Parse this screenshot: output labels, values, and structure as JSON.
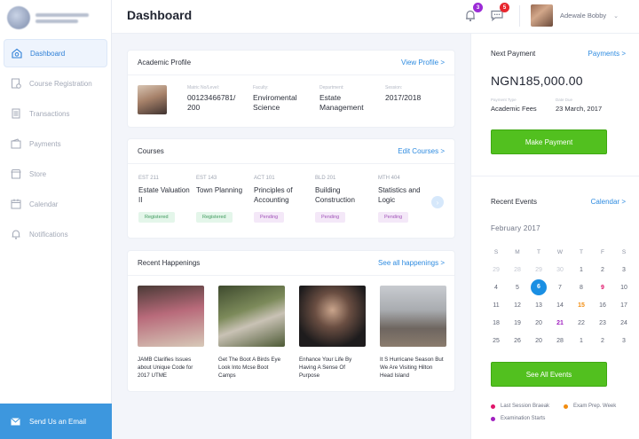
{
  "colors": {
    "accent": "#2e8be0",
    "brand_green": "#52c01f",
    "sidebar_button": "#3d97de",
    "today": "#1a8fe3",
    "event_red": "#e0156a",
    "event_orange": "#f28c0f",
    "event_purple": "#a020c0"
  },
  "sidebar": {
    "items": [
      {
        "label": "Dashboard",
        "icon": "home-icon"
      },
      {
        "label": "Course Registration",
        "icon": "document-icon"
      },
      {
        "label": "Transactions",
        "icon": "list-icon"
      },
      {
        "label": "Payments",
        "icon": "wallet-icon"
      },
      {
        "label": "Store",
        "icon": "store-icon"
      },
      {
        "label": "Calendar",
        "icon": "calendar-icon"
      },
      {
        "label": "Notifications",
        "icon": "bell-icon"
      }
    ],
    "send_email": "Send Us an Email"
  },
  "header": {
    "title": "Dashboard",
    "notifications_count": "3",
    "messages_count": "5",
    "user_name": "Adewale Bobby"
  },
  "academic_profile": {
    "title": "Academic Profile",
    "link": "View Profile >",
    "fields": [
      {
        "label": "Matric No/Level:",
        "value": "00123466781/ 200"
      },
      {
        "label": "Faculty:",
        "value": "Enviromental Science"
      },
      {
        "label": "Department:",
        "value": "Estate Management"
      },
      {
        "label": "Session:",
        "value": "2017/2018"
      }
    ]
  },
  "courses": {
    "title": "Courses",
    "link": "Edit Courses >",
    "items": [
      {
        "code": "EST 211",
        "name": "Estate Valuation II",
        "status": "Registered"
      },
      {
        "code": "EST 143",
        "name": "Town Planning",
        "status": "Registered"
      },
      {
        "code": "ACT 101",
        "name": "Principles of Accounting",
        "status": "Pending"
      },
      {
        "code": "BLD 201",
        "name": "Building Construction",
        "status": "Pending"
      },
      {
        "code": "MTH 404",
        "name": "Statistics and Logic",
        "status": "Pending"
      }
    ]
  },
  "happenings": {
    "title": "Recent Happenings",
    "link": "See all happenings >",
    "items": [
      {
        "text": "JAMB Clarifies Issues about Unique Code for 2017 UTME"
      },
      {
        "text": "Get The Boot A Birds Eye Look Into Mcse Boot Camps"
      },
      {
        "text": "Enhance Your Life By Having A Sense Of Purpose"
      },
      {
        "text": "It S Hurricane Season But We Are Visiting Hilton Head Island"
      }
    ]
  },
  "next_payment": {
    "title": "Next Payment",
    "link": "Payments >",
    "amount": "NGN185,000.00",
    "type_label": "Payment Type",
    "type_value": "Academic Fees",
    "due_label": "Date Due",
    "due_value": "23 March, 2017",
    "button": "Make Payment"
  },
  "events": {
    "title": "Recent Events",
    "link": "Calendar >",
    "month": "February 2017",
    "weekdays": [
      "S",
      "M",
      "T",
      "W",
      "T",
      "F",
      "S"
    ],
    "weeks": [
      [
        "29",
        "28",
        "29",
        "30",
        "1",
        "2",
        "3"
      ],
      [
        "4",
        "5",
        "6",
        "7",
        "8",
        "9",
        "10"
      ],
      [
        "11",
        "12",
        "13",
        "14",
        "15",
        "16",
        "17"
      ],
      [
        "18",
        "19",
        "20",
        "21",
        "22",
        "23",
        "24"
      ],
      [
        "25",
        "26",
        "20",
        "28",
        "1",
        "2",
        "3"
      ]
    ],
    "button": "See All Events",
    "legend": [
      {
        "label": "Last Session Braeak",
        "color": "#e0156a"
      },
      {
        "label": "Exam Prep. Week",
        "color": "#f28c0f"
      },
      {
        "label": "Examination Starts",
        "color": "#a020c0"
      }
    ]
  }
}
